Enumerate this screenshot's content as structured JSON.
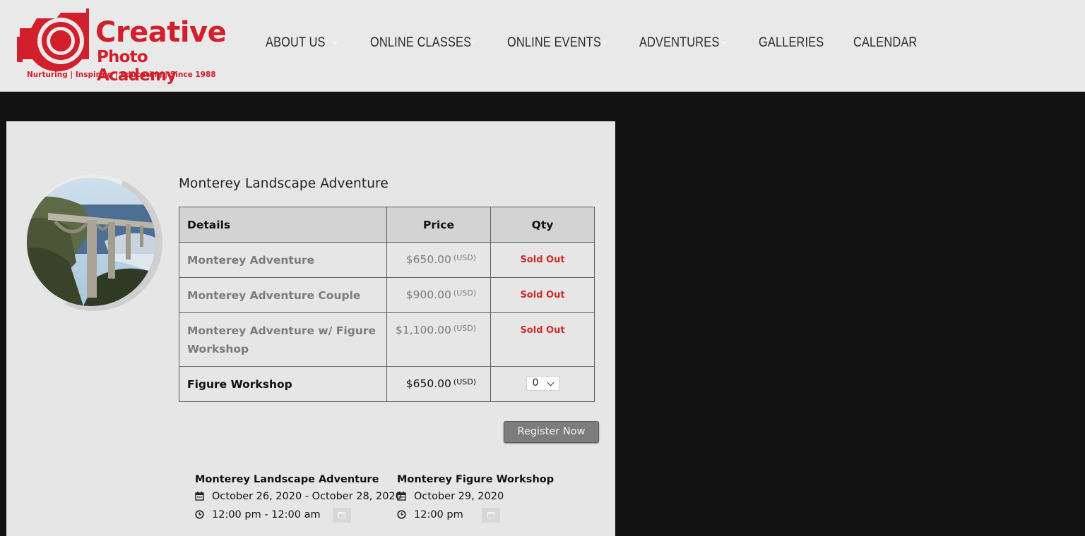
{
  "header": {
    "logo": {
      "line1": "Creative",
      "line2": "Photo Academy",
      "tagline": "Nurturing | Inspiring | Educating | Since 1988"
    },
    "nav": [
      {
        "label": "ABOUT US",
        "has_caret": true
      },
      {
        "label": "ONLINE CLASSES",
        "has_caret": true
      },
      {
        "label": "ONLINE EVENTS",
        "has_caret": true
      },
      {
        "label": "ADVENTURES",
        "has_caret": true
      },
      {
        "label": "GALLERIES",
        "has_caret": false
      },
      {
        "label": "CALENDAR",
        "has_caret": false
      }
    ]
  },
  "event": {
    "title": "Monterey Landscape Adventure",
    "table": {
      "headers": {
        "details": "Details",
        "price": "Price",
        "qty": "Qty"
      },
      "rows": [
        {
          "name": "Monterey Adventure",
          "price": "$650.00",
          "currency": "(USD)",
          "qty": "Sold Out"
        },
        {
          "name": "Monterey Adventure Couple",
          "price": "$900.00",
          "currency": "(USD)",
          "qty": "Sold Out"
        },
        {
          "name": "Monterey Adventure w/ Figure Workshop",
          "price": "$1,100.00",
          "currency": "(USD)",
          "qty": "Sold Out"
        },
        {
          "name": "Figure Workshop",
          "price": "$650.00",
          "currency": "(USD)",
          "qty_select": "0"
        }
      ]
    },
    "register_label": "Register Now",
    "dates": [
      {
        "title": "Monterey Landscape Adventure",
        "date": "October 26, 2020 - October 28, 2020",
        "time": "12:00 pm - 12:00 am"
      },
      {
        "title": "Monterey Figure Workshop",
        "date": "October 29, 2020",
        "time": "12:00 pm"
      }
    ]
  },
  "colors": {
    "brand_red": "#d11f2b",
    "sold_out": "#d12a2a",
    "header_bg": "#e9e9e9",
    "page_bg": "#121212",
    "card_bg": "#e6e6e6"
  }
}
